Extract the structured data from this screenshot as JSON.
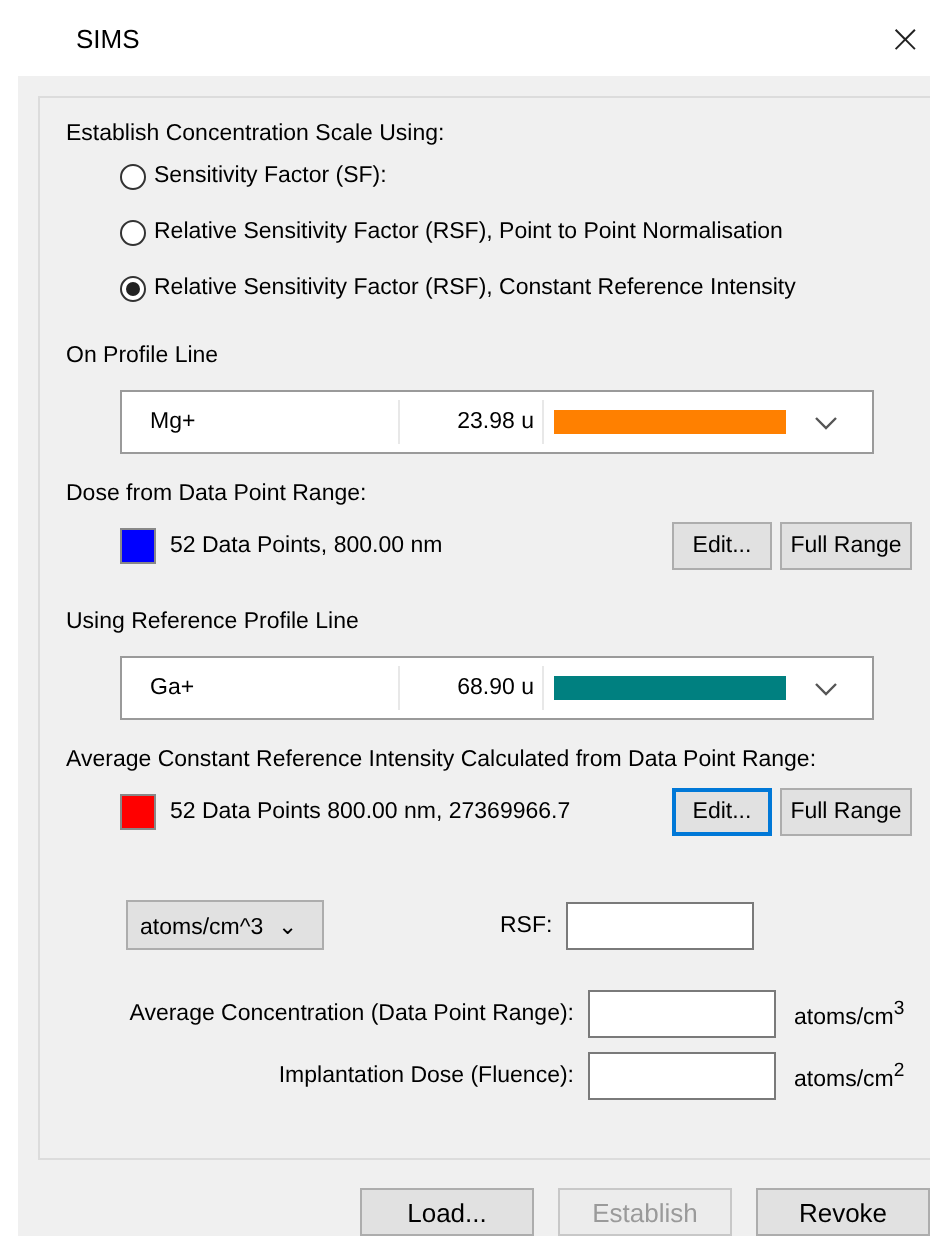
{
  "window": {
    "title": "SIMS",
    "close": "×"
  },
  "scale": {
    "heading": "Establish Concentration Scale Using:",
    "options": [
      {
        "label": "Sensitivity Factor (SF):",
        "selected": false
      },
      {
        "label": "Relative Sensitivity Factor (RSF), Point to Point Normalisation",
        "selected": false
      },
      {
        "label": "Relative Sensitivity Factor (RSF), Constant Reference Intensity",
        "selected": true
      }
    ]
  },
  "sections": [
    {
      "heading": "On Profile Line",
      "profile": {
        "name": "Mg+",
        "mass": "23.98 u",
        "color": "#ff8000"
      },
      "range_heading": "Dose from Data Point Range:",
      "range": {
        "color": "#0000ff",
        "text": "52 Data Points,  800.00 nm",
        "edit": {
          "label": "Edit...",
          "focused": false
        },
        "full": "Full Range"
      }
    },
    {
      "heading": "Using Reference Profile Line",
      "profile": {
        "name": "Ga+",
        "mass": "68.90 u",
        "color": "#008080"
      },
      "range_heading": "Average Constant Reference Intensity Calculated from Data Point Range:",
      "range": {
        "color": "#ff0000",
        "text": "52 Data Points 800.00 nm, 27369966.7",
        "edit": {
          "label": "Edit...",
          "focused": true
        },
        "full": "Full Range"
      }
    }
  ],
  "units": {
    "value": "atoms/cm^3",
    "caret": "⌄"
  },
  "rsf": {
    "label": "RSF:"
  },
  "results": [
    {
      "label": "Average Concentration (Data Point Range):",
      "unit": "atoms/cm$^{3}$"
    },
    {
      "label": "Implantation Dose (Fluence):",
      "unit": "atoms/cm$^{2}$"
    }
  ],
  "buttons": [
    {
      "label": "Load...",
      "disabled": false
    },
    {
      "label": "Establish",
      "disabled": true
    },
    {
      "label": "Revoke",
      "disabled": false
    }
  ]
}
